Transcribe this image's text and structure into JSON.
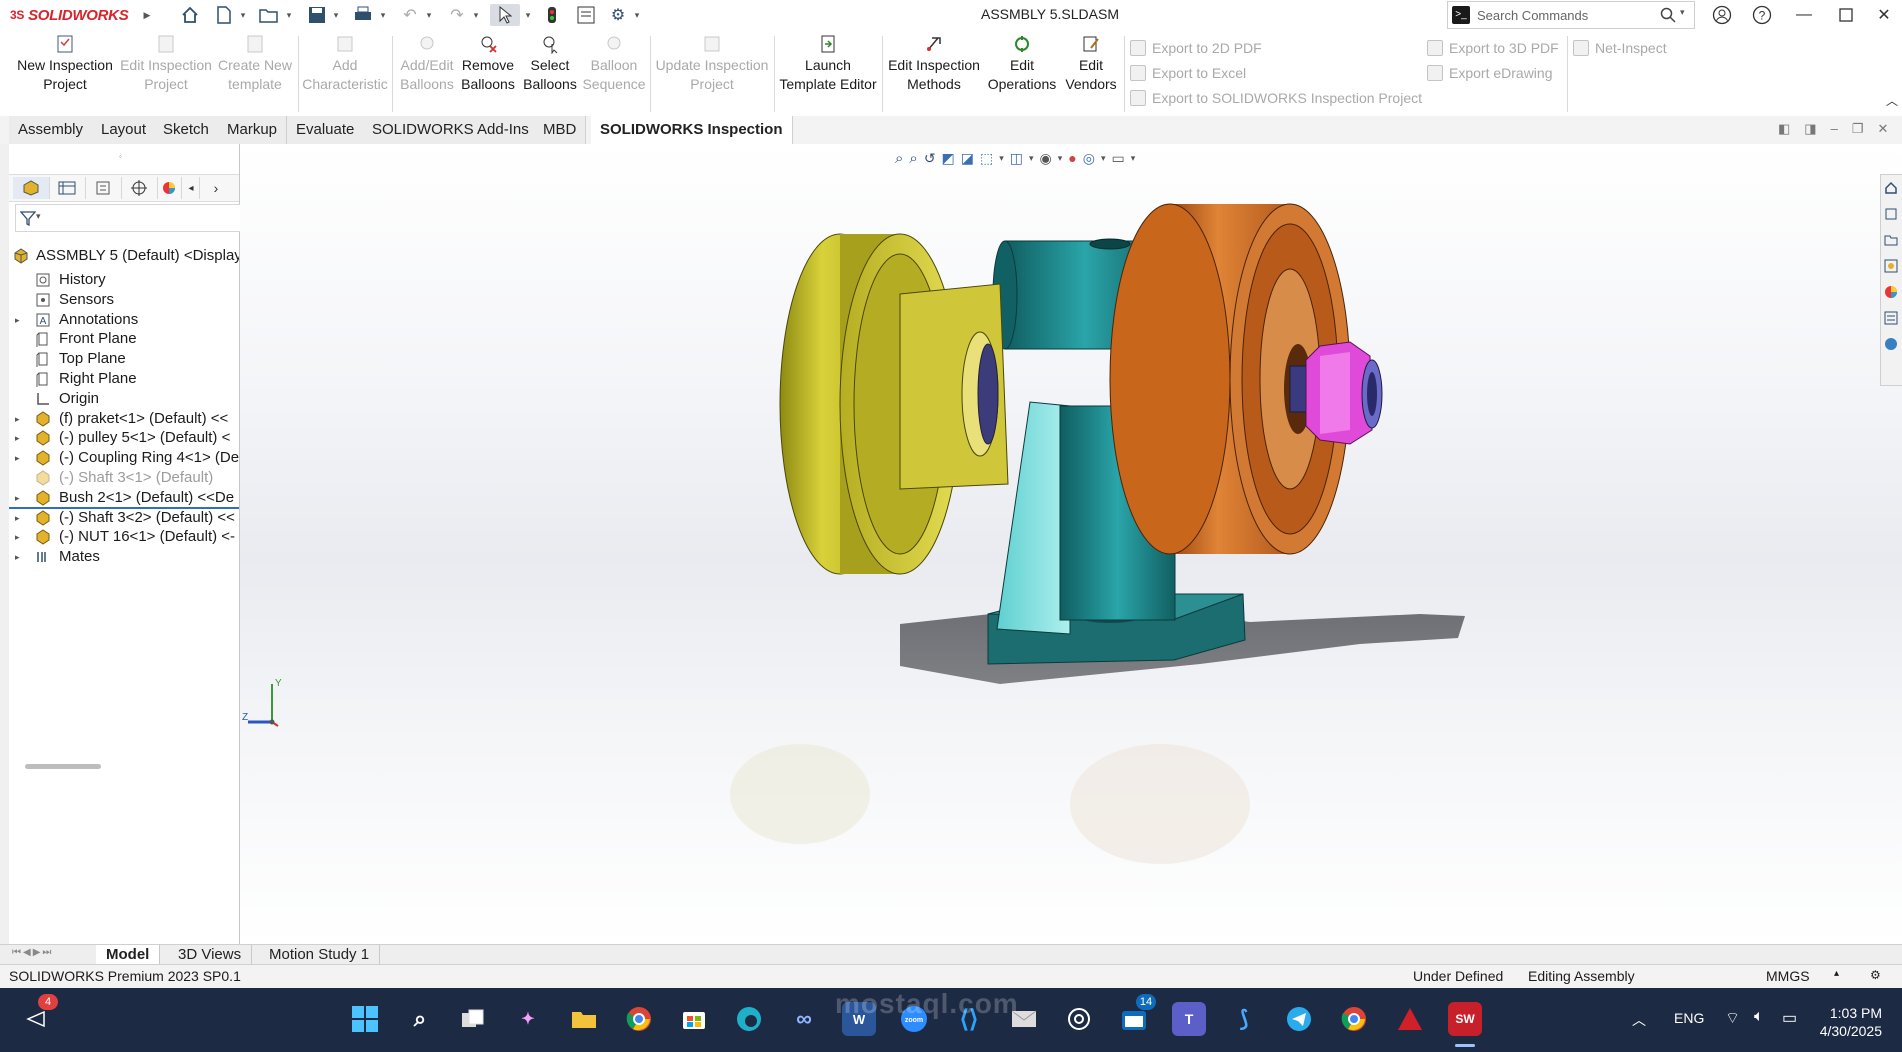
{
  "app": {
    "brand": "SOLIDWORKS",
    "document_title": "ASSMBLY 5.SLDASM"
  },
  "search": {
    "placeholder": "Search Commands"
  },
  "command_manager": {
    "buttons": [
      {
        "label": "New Inspection Project",
        "enabled": true
      },
      {
        "label": "Edit Inspection Project",
        "enabled": false
      },
      {
        "label": "Create New template",
        "enabled": false
      },
      {
        "label": "Add Characteristic",
        "enabled": false
      },
      {
        "label": "Add/Edit Balloons",
        "enabled": false
      },
      {
        "label": "Remove Balloons",
        "enabled": true
      },
      {
        "label": "Select Balloons",
        "enabled": true
      },
      {
        "label": "Balloon Sequence",
        "enabled": false
      },
      {
        "label": "Update Inspection Project",
        "enabled": false
      },
      {
        "label": "Launch Template Editor",
        "enabled": true
      },
      {
        "label": "Edit Inspection Methods",
        "enabled": true
      },
      {
        "label": "Edit Operations",
        "enabled": true
      },
      {
        "label": "Edit Vendors",
        "enabled": true
      }
    ],
    "export": [
      {
        "label": "Export to 2D PDF"
      },
      {
        "label": "Export to Excel"
      },
      {
        "label": "Export to SOLIDWORKS Inspection Project"
      },
      {
        "label": "Export to 3D PDF"
      },
      {
        "label": "Export eDrawing"
      },
      {
        "label": "Net-Inspect"
      }
    ]
  },
  "tabs": [
    "Assembly",
    "Layout",
    "Sketch",
    "Markup",
    "Evaluate",
    "SOLIDWORKS Add-Ins",
    "MBD",
    "SOLIDWORKS Inspection"
  ],
  "active_tab": "SOLIDWORKS Inspection",
  "feature_tree": {
    "root": "ASSMBLY 5 (Default) <Display",
    "items": [
      {
        "label": "History",
        "expandable": false,
        "icon": "history-icon",
        "dim": false
      },
      {
        "label": "Sensors",
        "expandable": false,
        "icon": "sensors-icon",
        "dim": false
      },
      {
        "label": "Annotations",
        "expandable": true,
        "icon": "annotations-icon",
        "dim": false
      },
      {
        "label": "Front Plane",
        "expandable": false,
        "icon": "plane-icon",
        "dim": false
      },
      {
        "label": "Top Plane",
        "expandable": false,
        "icon": "plane-icon",
        "dim": false
      },
      {
        "label": "Right Plane",
        "expandable": false,
        "icon": "plane-icon",
        "dim": false
      },
      {
        "label": "Origin",
        "expandable": false,
        "icon": "origin-icon",
        "dim": false
      },
      {
        "label": "(f) praket<1> (Default) <<",
        "expandable": true,
        "icon": "part-icon",
        "dim": false
      },
      {
        "label": "(-) pulley 5<1> (Default) <",
        "expandable": true,
        "icon": "part-icon",
        "dim": false
      },
      {
        "label": "(-) Coupling Ring 4<1> (De",
        "expandable": true,
        "icon": "part-icon",
        "dim": false
      },
      {
        "label": "(-) Shaft 3<1> (Default)",
        "expandable": false,
        "icon": "part-icon",
        "dim": true
      },
      {
        "label": "Bush 2<1> (Default) <<De",
        "expandable": true,
        "icon": "part-icon",
        "dim": false
      },
      {
        "label": "(-) Shaft 3<2> (Default) <<",
        "expandable": true,
        "icon": "part-icon",
        "dim": false
      },
      {
        "label": "(-) NUT 16<1> (Default) <-",
        "expandable": true,
        "icon": "part-icon",
        "dim": false
      },
      {
        "label": "Mates",
        "expandable": true,
        "icon": "mates-icon",
        "dim": false
      }
    ]
  },
  "triad": {
    "y": "Y",
    "z": "Z"
  },
  "bottom_tabs": [
    "Model",
    "3D Views",
    "Motion Study 1"
  ],
  "status": {
    "version": "SOLIDWORKS Premium 2023 SP0.1",
    "state": "Under Defined",
    "mode": "Editing Assembly",
    "units": "MMGS"
  },
  "taskbar": {
    "notification_badge": "4",
    "teams_badge": "14",
    "language": "ENG",
    "time": "1:03 PM",
    "date": "4/30/2025",
    "watermark": "mostaql.com"
  },
  "colors": {
    "pulley_left": "#c9c22a",
    "pulley_right": "#c8661b",
    "bracket": "#1f7c80",
    "nut": "#e04ad8",
    "accent": "#d8232a"
  }
}
